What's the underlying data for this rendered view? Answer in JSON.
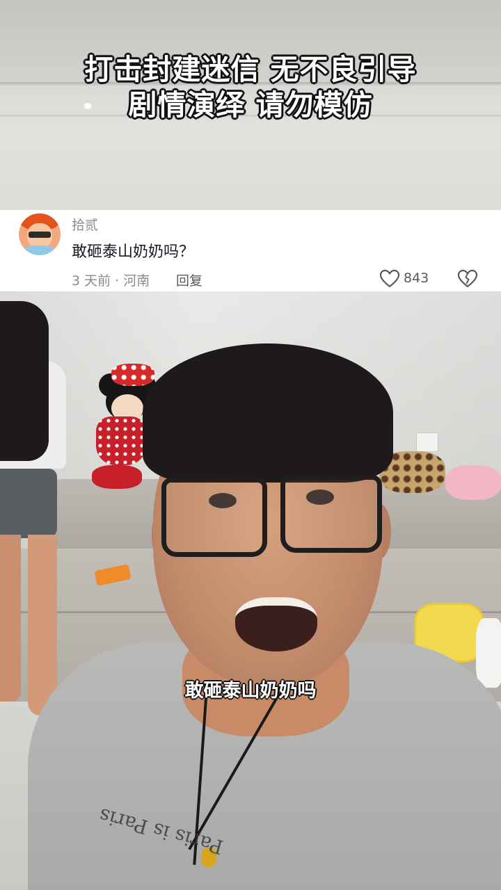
{
  "top_video": {
    "warning_line1": "打击封建迷信 无不良引导",
    "warning_line2": "剧情演绎 请勿模仿"
  },
  "comment": {
    "username": "拾贰",
    "text": "敢砸泰山奶奶吗？",
    "meta": "3 天前 · 河南",
    "reply_label": "回复",
    "like_count": "843",
    "like_icon": "heart-outline-icon",
    "dislike_icon": "broken-heart-icon"
  },
  "bottom_video": {
    "subtitle": "敢砸泰山奶奶吗",
    "shirt_print": "Paris is Paris"
  }
}
